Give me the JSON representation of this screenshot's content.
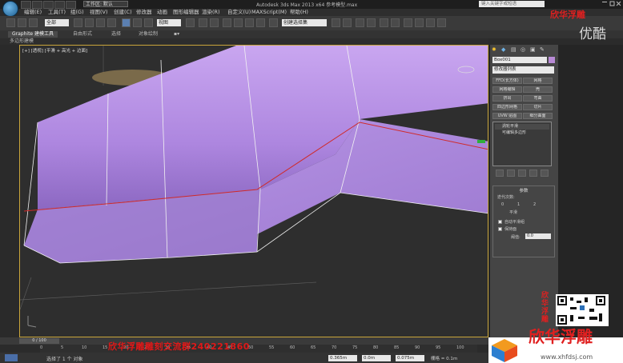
{
  "titlebar": {
    "workspace": "工作区: 默认",
    "app_title": "Autodesk 3ds Max  2013 x64    参考模型.max",
    "help_search_placeholder": "键入关键字或短语"
  },
  "menubar": {
    "items": [
      "编辑(E)",
      "工具(T)",
      "组(G)",
      "视图(V)",
      "创建(C)",
      "修改器",
      "动画",
      "图形编辑器",
      "渲染(R)",
      "自定义(U)",
      "MAXScript(M)",
      "帮助(H)"
    ]
  },
  "toolbar": {
    "selection_filter": "全部",
    "ref_coord": "视图",
    "named_selection": "创建选择集"
  },
  "ribbon": {
    "tabs": [
      "Graphite 建模工具",
      "自由形式",
      "选择",
      "对象绘制"
    ],
    "active_tab": 0,
    "sub_label": "多边形建模"
  },
  "viewport": {
    "label": "[+] [透视] [平滑 + 高光 + 边面]",
    "mesh_color": "#b48be0",
    "edge_color": "#cc2b2b"
  },
  "command_panel": {
    "object_name": "Box001",
    "object_color": "#b88ad6",
    "modifier_list": "修改器列表",
    "buttons": [
      "FFD(长方体)",
      "网格",
      "网格编辑",
      "壳",
      "挤出",
      "弯曲",
      "四边形网格",
      "切片",
      "UVW 贴图",
      "细分曲面"
    ],
    "stack_items": [
      "涡轮平滑",
      "可编辑多边形"
    ],
    "params_title": "参数",
    "params": {
      "iterations_label": "迭代次数:",
      "radio_values": [
        "0",
        "1",
        "2"
      ],
      "smooth_label": "平滑",
      "auto_smooth": "自动平滑组",
      "keep_faces": "保持面",
      "threshold_label": "阈值:",
      "threshold_value": "0.0"
    }
  },
  "timeline": {
    "slider_label": "0 / 100",
    "ticks": [
      "0",
      "5",
      "10",
      "15",
      "20",
      "25",
      "30",
      "35",
      "40",
      "45",
      "50",
      "55",
      "60",
      "65",
      "70",
      "75",
      "80",
      "85",
      "90",
      "95",
      "100"
    ]
  },
  "statusbar": {
    "text": "选择了 1 个 对象",
    "x_value": "0.365m",
    "y_value": "0.0m",
    "z_value": "0.075m",
    "grid": "栅格 = 0.1m"
  },
  "overlays": {
    "ad_banner": "欣华浮雕雕刻交流群240221860",
    "brand_name": "欣华浮雕",
    "brand_vertical": "欣华浮雕",
    "brand_domain": "www.xhfdsj.com",
    "watermark_top": "欣华浮雕",
    "watermark_youku": "优酷"
  }
}
